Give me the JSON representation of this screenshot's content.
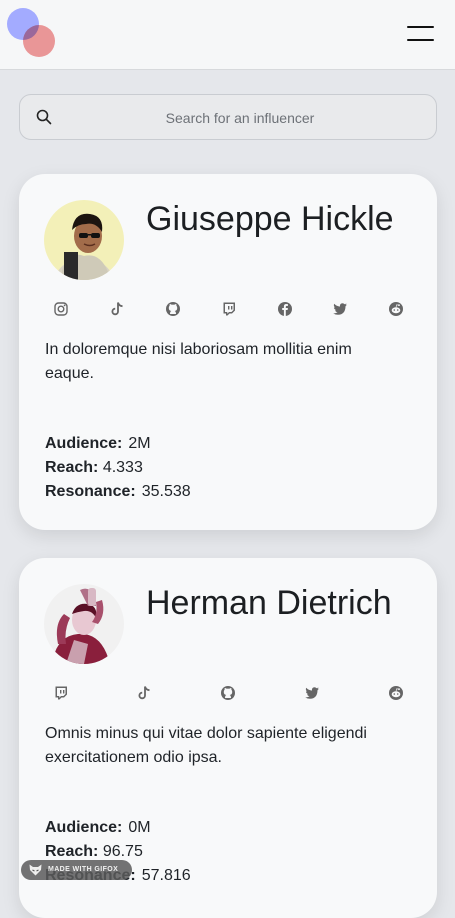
{
  "header": {
    "logo_icon": "overlapping-circles-logo",
    "menu_icon": "hamburger-menu-icon"
  },
  "search": {
    "placeholder": "Search for an influencer",
    "value": ""
  },
  "influencers": [
    {
      "name": "Giuseppe Hickle",
      "socials": [
        "instagram",
        "tiktok",
        "github",
        "twitch",
        "facebook",
        "twitter",
        "reddit"
      ],
      "description": "In doloremque nisi laboriosam mollitia enim eaque.",
      "audience_label": "Audience:",
      "audience": "2M",
      "reach_label": "Reach:",
      "reach": "4.333",
      "resonance_label": "Resonance:",
      "resonance": "35.538"
    },
    {
      "name": "Herman Dietrich",
      "socials": [
        "twitch",
        "tiktok",
        "github",
        "twitter",
        "reddit"
      ],
      "description": "Omnis minus qui vitae dolor sapiente eligendi exercitationem odio ipsa.",
      "audience_label": "Audience:",
      "audience": "0M",
      "reach_label": "Reach:",
      "reach": "96.75",
      "resonance_label": "Resonance:",
      "resonance": "57.816"
    }
  ],
  "watermark": {
    "text": "MADE WITH GIFOX"
  },
  "colors": {
    "page_bg": "#e5e7eb",
    "card_bg": "#f8f9fa",
    "logo_blue": "#9ea7ff",
    "logo_red": "#f29b9b"
  }
}
